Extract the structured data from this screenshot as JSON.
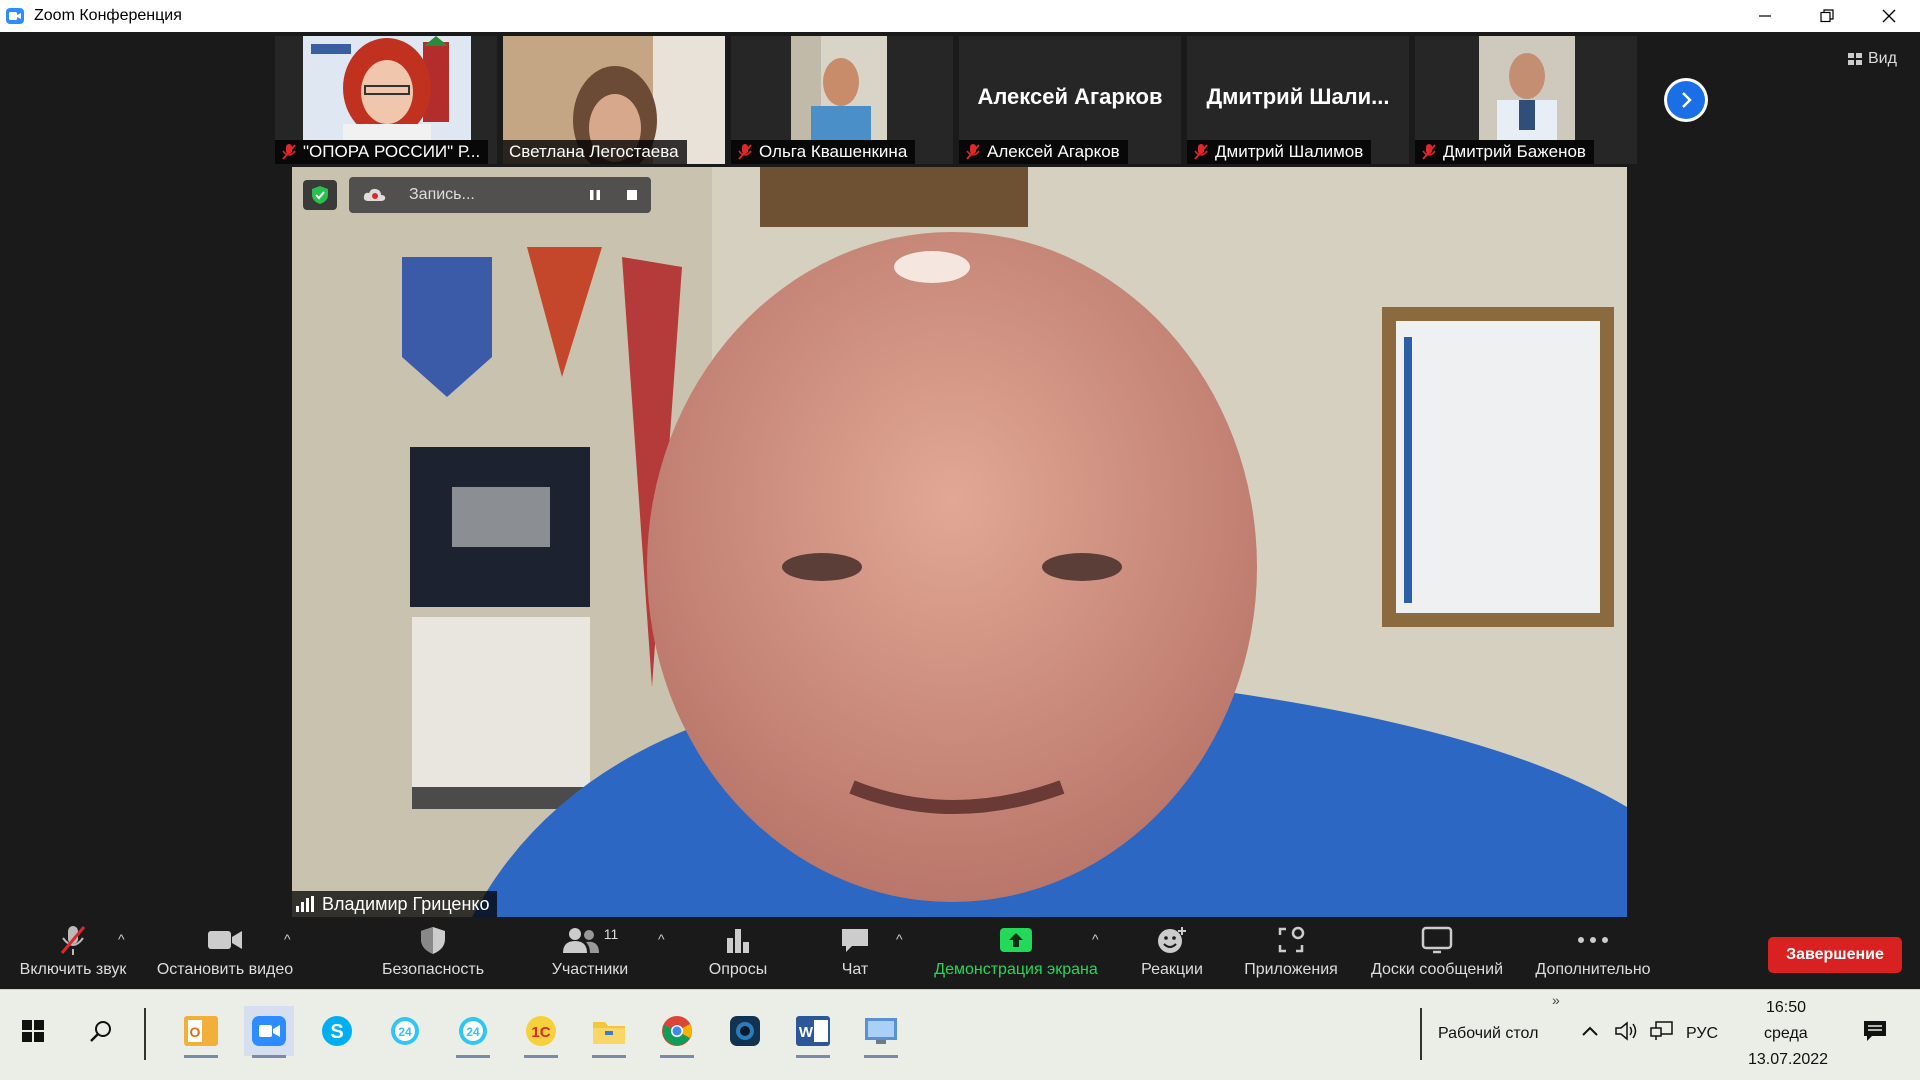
{
  "window": {
    "title": "Zoom Конференция"
  },
  "gallery": {
    "participants": [
      {
        "name": "\"ОПОРА РОССИИ\" Р...",
        "muted": true,
        "video": true
      },
      {
        "name": "Светлана Легостаева",
        "muted": false,
        "video": true
      },
      {
        "name": "Ольга Квашенкина",
        "muted": true,
        "video": true
      },
      {
        "name": "Алексей Агарков",
        "display_name": "Алексей Агарков",
        "muted": true,
        "video": false
      },
      {
        "name": "Дмитрий Шалимов",
        "display_name": "Дмитрий  Шали...",
        "muted": true,
        "video": false
      },
      {
        "name": "Дмитрий Баженов",
        "muted": true,
        "video": true
      }
    ],
    "view_label": "Вид"
  },
  "main_video": {
    "speaker_name": "Владимир Гриценко"
  },
  "recording": {
    "label": "Запись..."
  },
  "toolbar": {
    "unmute": "Включить звук",
    "stop_video": "Остановить видео",
    "security": "Безопасность",
    "participants": "Участники",
    "participants_count": "11",
    "polls": "Опросы",
    "chat": "Чат",
    "share_screen": "Демонстрация экрана",
    "reactions": "Реакции",
    "apps": "Приложения",
    "whiteboards": "Доски сообщений",
    "more": "Дополнительно",
    "end": "Завершение"
  },
  "taskbar": {
    "desktop_label": "Рабочий стол",
    "language": "РУС",
    "time": "16:50",
    "weekday": "среда",
    "date": "13.07.2022"
  },
  "colors": {
    "accent_blue": "#2d8cff",
    "end_red": "#d92121",
    "share_green": "#23d959",
    "muted_red": "#e02828"
  }
}
